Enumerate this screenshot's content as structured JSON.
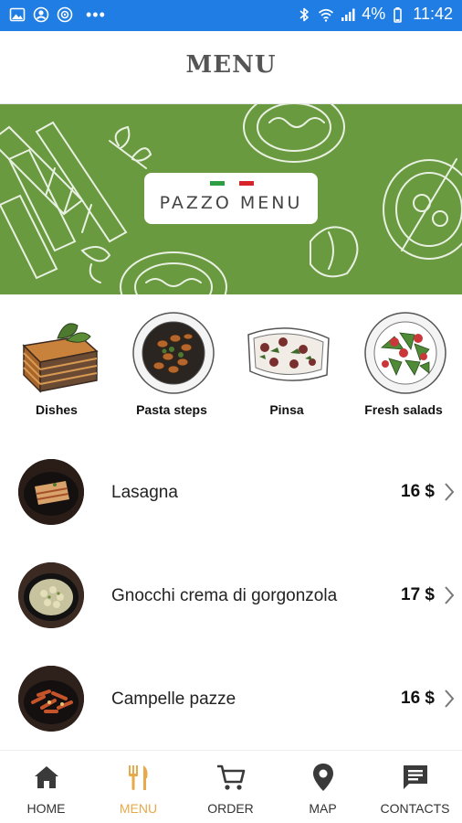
{
  "status_bar": {
    "battery": "4%",
    "time": "11:42",
    "dots": "•••"
  },
  "header": {
    "title": "MENU"
  },
  "banner": {
    "card_text": "PAZZO MENU",
    "flag_colors": [
      "#2e9e45",
      "#ffffff",
      "#d6242b"
    ]
  },
  "categories": [
    {
      "label": "Dishes"
    },
    {
      "label": "Pasta steps"
    },
    {
      "label": "Pinsa"
    },
    {
      "label": "Fresh salads"
    }
  ],
  "items": [
    {
      "name": "Lasagna",
      "price": "16 $"
    },
    {
      "name": "Gnocchi crema di gorgonzola",
      "price": "17 $"
    },
    {
      "name": "Campelle pazze",
      "price": "16 $"
    }
  ],
  "nav": [
    {
      "label": "HOME",
      "icon": "home-icon"
    },
    {
      "label": "MENU",
      "icon": "cutlery-icon",
      "active": true
    },
    {
      "label": "ORDER",
      "icon": "cart-icon"
    },
    {
      "label": "MAP",
      "icon": "map-pin-icon"
    },
    {
      "label": "CONTACTS",
      "icon": "chat-icon"
    }
  ],
  "colors": {
    "status_bar": "#1f7de4",
    "banner_green": "#6a9a3f",
    "active_nav": "#e8a94a",
    "nav_icon": "#3a3a3a"
  }
}
